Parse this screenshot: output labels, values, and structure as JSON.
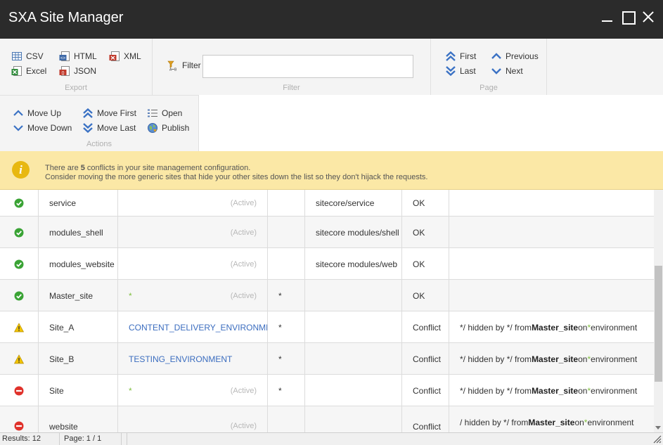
{
  "window": {
    "title": "SXA Site Manager"
  },
  "ribbon": {
    "export": {
      "label": "Export",
      "csv": "CSV",
      "excel": "Excel",
      "html": "HTML",
      "json": "JSON",
      "xml": "XML"
    },
    "filter": {
      "label": "Filter",
      "button": "Filter",
      "value": "",
      "placeholder": ""
    },
    "page": {
      "label": "Page",
      "first": "First",
      "last": "Last",
      "previous": "Previous",
      "next": "Next"
    },
    "actions": {
      "label": "Actions",
      "move_up": "Move Up",
      "move_down": "Move Down",
      "move_first": "Move First",
      "move_last": "Move Last",
      "open": "Open",
      "publish": "Publish"
    }
  },
  "notice": {
    "prefix": "There are ",
    "count": "5",
    "suffix": " conflicts in your site management configuration.",
    "line2": "Consider moving the more generic sites that hide your other sites down the list so they don't hijack the requests."
  },
  "rows": [
    {
      "status_icon": "check-icon",
      "name": "service",
      "env": "",
      "active": "(Active)",
      "star": "",
      "path": "sitecore/service",
      "status": "OK",
      "msg": null
    },
    {
      "status_icon": "check-icon",
      "name": "modules_shell",
      "env": "",
      "active": "(Active)",
      "star": "",
      "path": "sitecore modules/shell",
      "status": "OK",
      "msg": null
    },
    {
      "status_icon": "check-icon",
      "name": "modules_website",
      "env": "",
      "active": "(Active)",
      "star": "",
      "path": "sitecore modules/web",
      "status": "OK",
      "msg": null
    },
    {
      "status_icon": "check-icon",
      "name": "Master_site",
      "env": "*",
      "active": "(Active)",
      "star": "*",
      "path": "",
      "status": "OK",
      "msg": null
    },
    {
      "status_icon": "warning-icon",
      "name": "Site_A",
      "env": "CONTENT_DELIVERY_ENVIRONMENT",
      "active": "",
      "star": "*",
      "path": "",
      "status": "Conflict",
      "msg": {
        "a": "*/  hidden by */ from ",
        "site": "Master_site",
        "b": " on ",
        "env": "*",
        "c": " environment"
      }
    },
    {
      "status_icon": "warning-icon",
      "name": "Site_B",
      "env": "TESTING_ENVIRONMENT",
      "active": "",
      "star": "*",
      "path": "",
      "status": "Conflict",
      "msg": {
        "a": "*/  hidden by */ from ",
        "site": "Master_site",
        "b": " on ",
        "env": "*",
        "c": " environment"
      }
    },
    {
      "status_icon": "blocked-icon",
      "name": "Site",
      "env": "*",
      "active": "(Active)",
      "star": "*",
      "path": "",
      "status": "Conflict",
      "msg": {
        "a": "*/  hidden by */ from ",
        "site": "Master_site",
        "b": " on ",
        "env": "*",
        "c": " environment"
      }
    },
    {
      "status_icon": "blocked-icon",
      "name": "website",
      "env": "",
      "active": "(Active)",
      "star": "",
      "path": "",
      "status": "Conflict",
      "msg": {
        "a": "/  hidden by */ from ",
        "site": "Master_site",
        "b": " on ",
        "env": "*",
        "c": " environment"
      }
    }
  ],
  "statusbar": {
    "results": "Results: 12",
    "page": "Page: 1 / 1"
  },
  "colors": {
    "titlebar": "#2b2b2b",
    "notice": "#fbe8a6",
    "link": "#3b6dbf",
    "ok": "#3aa335",
    "warning": "#f2c400",
    "blocked": "#e0322b"
  }
}
